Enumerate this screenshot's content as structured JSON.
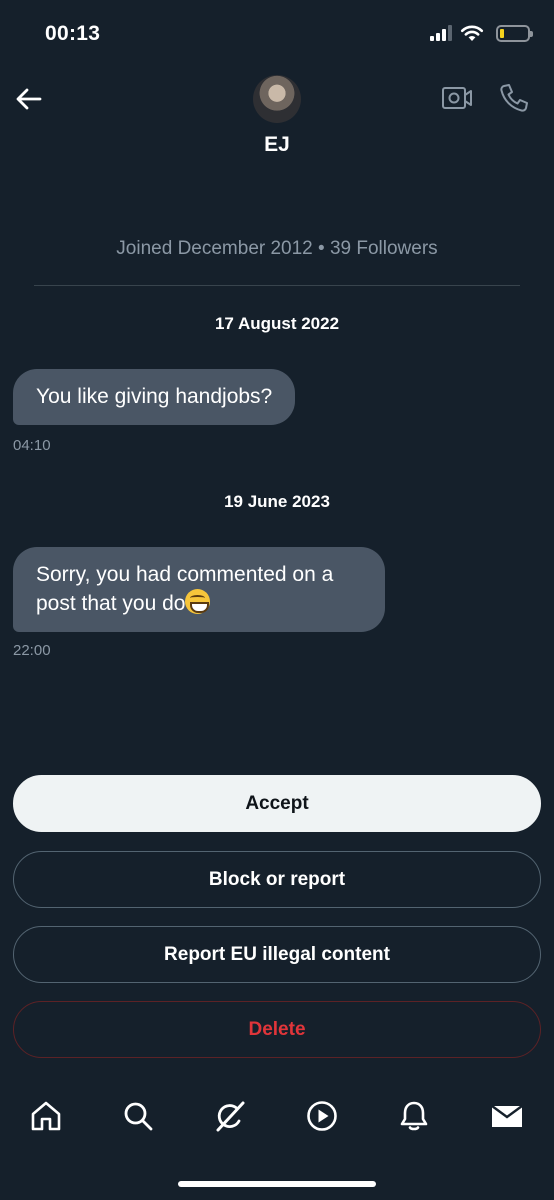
{
  "status_bar": {
    "time": "00:13",
    "battery_color": "#f4d21d"
  },
  "header": {
    "contact_name": "EJ",
    "icons": [
      "back-arrow-icon",
      "avatar",
      "video-camera-icon",
      "phone-icon"
    ]
  },
  "profile": {
    "meta": "Joined December 2012 • 39 Followers"
  },
  "conversation": [
    {
      "date": "17 August 2022",
      "text": "You like giving handjobs?",
      "time": "04:10",
      "emoji": ""
    },
    {
      "date": "19 June 2023",
      "text": "Sorry, you had commented on a post that you do",
      "time": "22:00",
      "emoji": "grinning-face"
    }
  ],
  "actions": {
    "accept": "Accept",
    "block_or_report": "Block or report",
    "report_eu": "Report EU illegal content",
    "delete": "Delete"
  },
  "tab_bar": {
    "tabs": [
      "home-icon",
      "search-icon",
      "grok-icon",
      "video-play-icon",
      "notifications-bell-icon",
      "messages-envelope-icon"
    ]
  },
  "colors": {
    "background": "#15202b",
    "bubble": "#4a5665",
    "accept_button": "#eff3f4",
    "delete_text": "#e0353a",
    "muted_text": "#8b98a5"
  }
}
